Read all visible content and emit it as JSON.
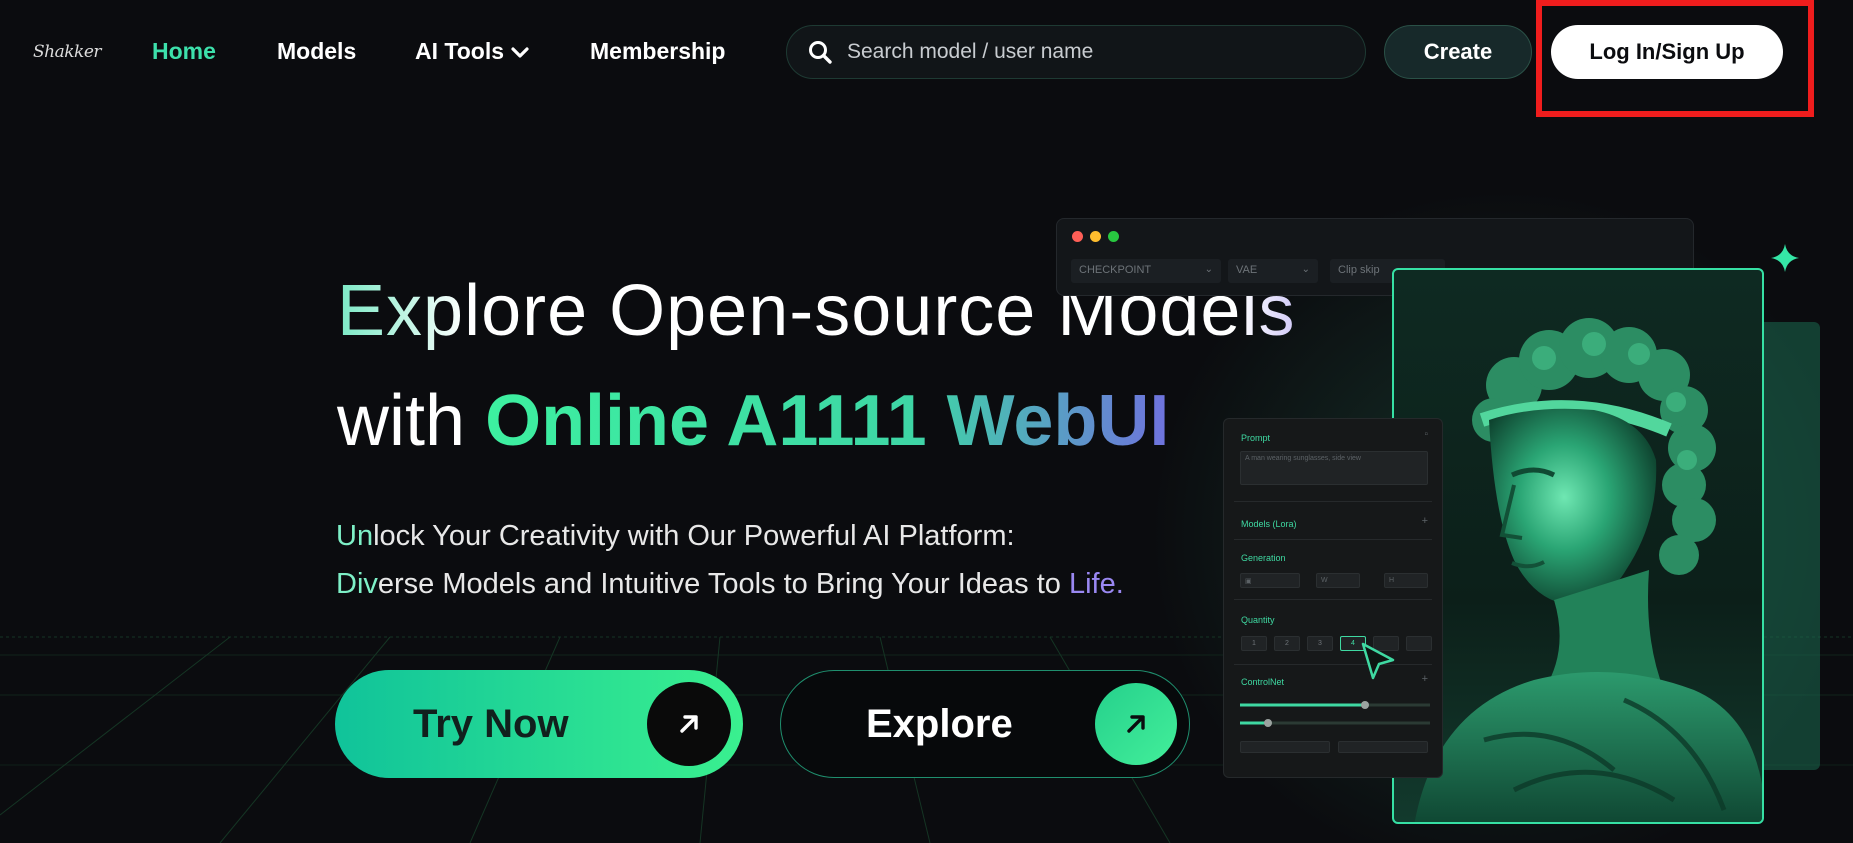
{
  "nav": {
    "logo_text": "Shakker",
    "links": [
      {
        "label": "Home",
        "active": true
      },
      {
        "label": "Models"
      },
      {
        "label": "AI Tools",
        "has_dropdown": true
      },
      {
        "label": "Membership"
      }
    ],
    "search_placeholder": "Search model / user name",
    "create_label": "Create",
    "login_label": "Log In/Sign Up"
  },
  "hero": {
    "headline_line1": "Explore Open-source Models",
    "headline_line2_prefix": "with",
    "headline_line2_highlight": "Online A1111 WebUI",
    "subtitle_line1_accent": "Un",
    "subtitle_line1_rest": "lock Your Creativity with Our Powerful AI Platform:",
    "subtitle_line2_accent": "Div",
    "subtitle_line2_rest": "erse Models and Intuitive Tools to Bring Your Ideas to ",
    "subtitle_line2_end": "Life."
  },
  "cta": {
    "try_label": "Try Now",
    "explore_label": "Explore"
  },
  "mock": {
    "selects": [
      "CHECKPOINT",
      "VAE",
      "Clip skip"
    ],
    "panel": {
      "prompt_label": "Prompt",
      "prompt_value": "A man wearing sunglasses, side view",
      "models_label": "Models (Lora)",
      "generation_label": "Generation",
      "gen_fields": [
        "W",
        "H"
      ],
      "quantity_label": "Quantity",
      "quantity_options": [
        "1",
        "2",
        "3",
        "4"
      ],
      "quantity_selected": "4",
      "controlnet_label": "ControlNet",
      "sliders": [
        0.66,
        0.15
      ]
    }
  },
  "colors": {
    "accent": "#3de0ab",
    "highlight_box": "#f01d1d",
    "purple": "#9a88f2"
  }
}
